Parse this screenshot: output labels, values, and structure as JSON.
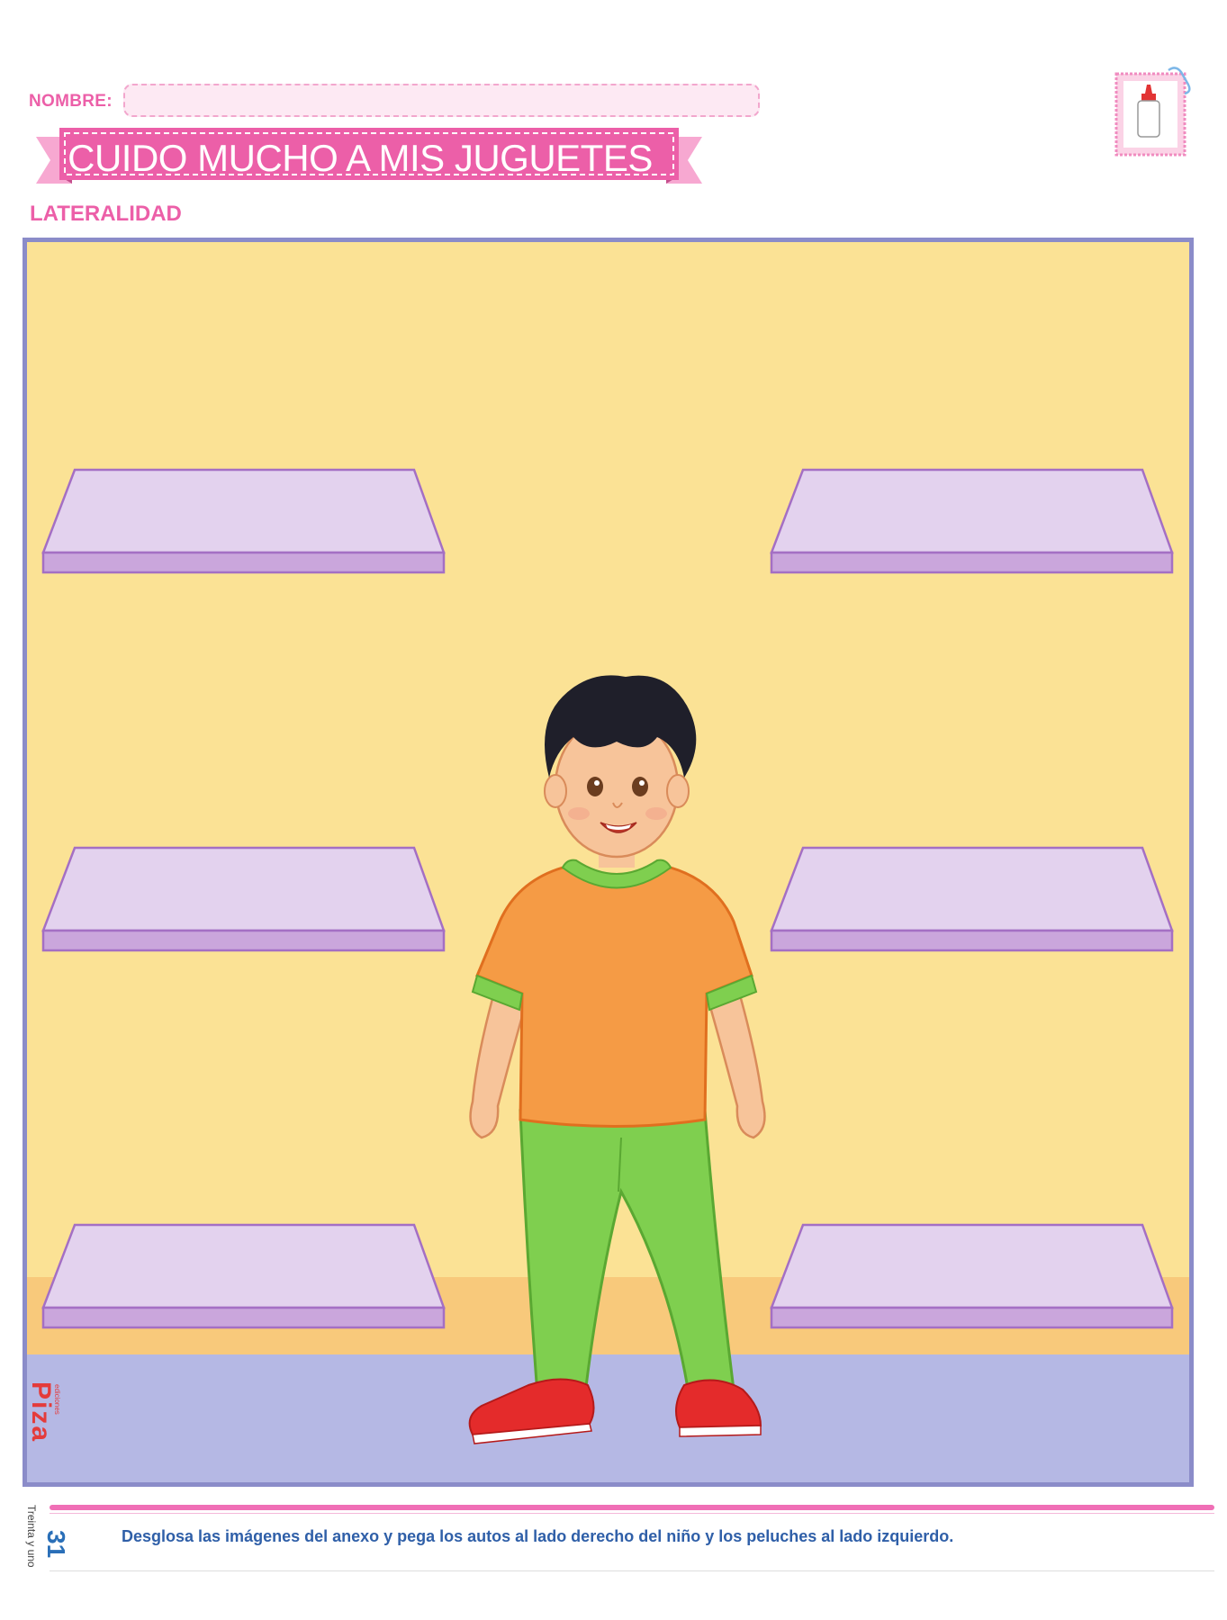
{
  "header": {
    "name_label": "NOMBRE:",
    "name_value": "",
    "title": "CUIDO MUCHO A MIS JUGUETES",
    "section": "LATERALIDAD"
  },
  "footer": {
    "instruction": "Desglosa las imágenes del anexo y pega los autos al lado derecho del niño y los peluches al lado izquierdo.",
    "page_number": "31",
    "page_words": "Treinta y uno"
  },
  "logo": {
    "brand": "Piza",
    "sub": "ediciones"
  },
  "colors": {
    "accent_pink": "#ec5fa8",
    "wall": "#fbe295",
    "floor": "#b5b8e4",
    "baseboard": "#f8c97b",
    "frame": "#8b8cc9",
    "shelf_top": "#e3d2ee",
    "shelf_front": "#caa6dc",
    "shelf_edge": "#a46fc4"
  },
  "icons": {
    "activity": "glue-bottle-icon"
  }
}
